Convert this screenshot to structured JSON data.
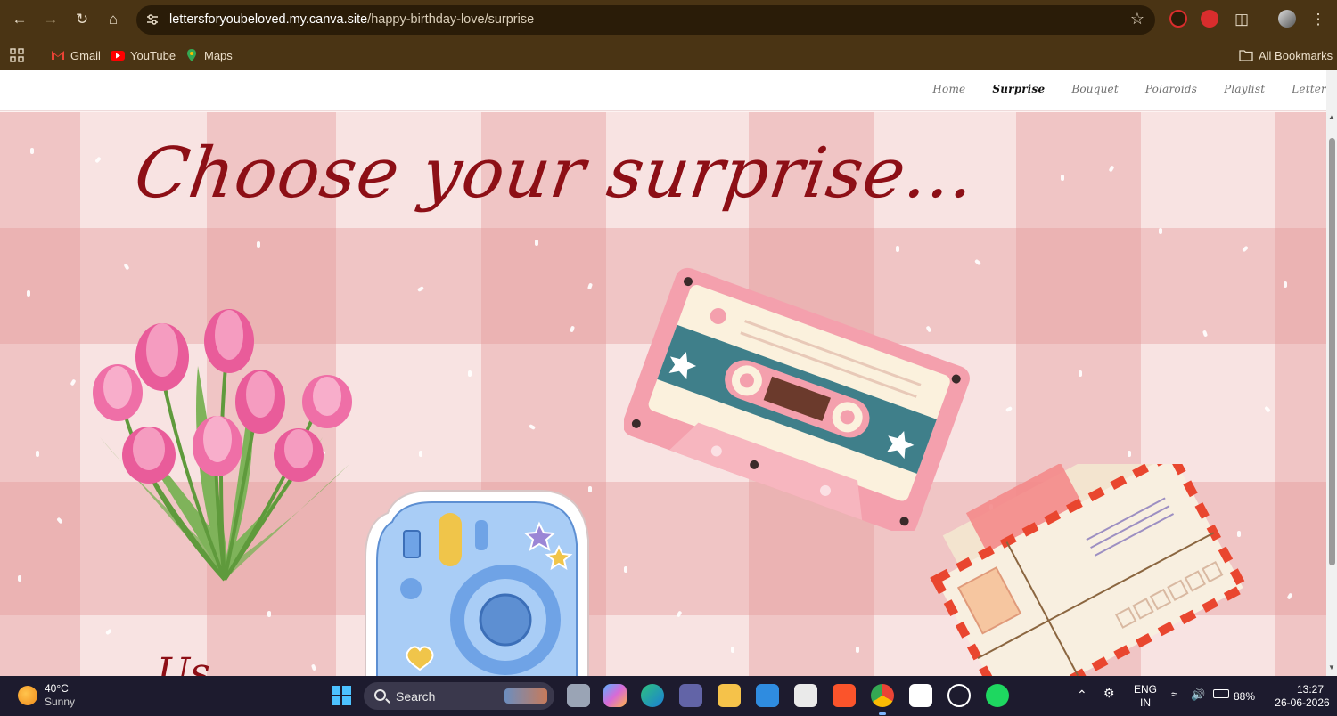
{
  "browser": {
    "url_host": "lettersforyoubeloved.my.canva.site",
    "url_path": "/happy-birthday-love/surprise",
    "bookmarks": [
      {
        "label": "Gmail",
        "icon": "gmail-icon"
      },
      {
        "label": "YouTube",
        "icon": "youtube-icon"
      },
      {
        "label": "Maps",
        "icon": "maps-icon"
      }
    ],
    "all_bookmarks_label": "All Bookmarks"
  },
  "site": {
    "nav": [
      "Home",
      "Surprise",
      "Bouquet",
      "Polaroids",
      "Playlist",
      "Letter"
    ],
    "active_nav": "Surprise",
    "headline": "Choose your surprise...",
    "partial_caption": "Us"
  },
  "colors": {
    "headline": "#8d0f16",
    "gingham": "#e4a3a3",
    "chrome": "#4a3414"
  },
  "taskbar": {
    "weather_temp": "40°C",
    "weather_desc": "Sunny",
    "search_label": "Search",
    "lang_top": "ENG",
    "lang_bottom": "IN",
    "battery": "88%",
    "time": "13:27",
    "date": "26-06-2026"
  }
}
